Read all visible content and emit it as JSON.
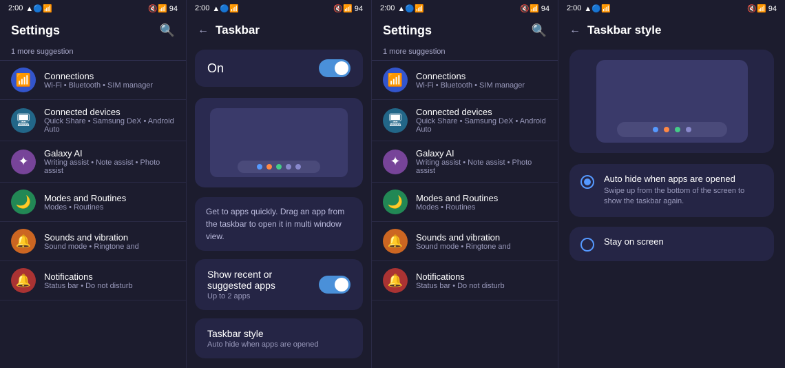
{
  "left_screen": {
    "status_bar": {
      "time": "2:00",
      "battery": "94"
    },
    "settings": {
      "title": "Settings",
      "suggestion": "1 more suggestion",
      "items": [
        {
          "id": "connections",
          "title": "Connections",
          "subtitle": "Wi-Fi • Bluetooth • SIM manager",
          "icon": "📶",
          "icon_color": "#2255cc"
        },
        {
          "id": "connected_devices",
          "title": "Connected devices",
          "subtitle": "Quick Share • Samsung DeX • Android Auto",
          "icon": "🖥",
          "icon_color": "#225588"
        },
        {
          "id": "galaxy_ai",
          "title": "Galaxy AI",
          "subtitle": "Writing assist • Note assist • Photo assist",
          "icon": "✦",
          "icon_color": "#774499"
        },
        {
          "id": "modes_routines",
          "title": "Modes and Routines",
          "subtitle": "Modes • Routines",
          "icon": "🌙",
          "icon_color": "#228855"
        },
        {
          "id": "sounds",
          "title": "Sounds and vibration",
          "subtitle": "Sound mode • Ringtone and",
          "icon": "🔔",
          "icon_color": "#cc6622"
        },
        {
          "id": "notifications",
          "title": "Notifications",
          "subtitle": "Status bar • Do not disturb",
          "icon": "🔔",
          "icon_color": "#aa3333"
        }
      ]
    }
  },
  "taskbar_panel": {
    "status_bar": {
      "time": "2:00",
      "battery": "94"
    },
    "title": "Taskbar",
    "on_label": "On",
    "on_toggle": true,
    "info_text": "Get to apps quickly. Drag an app from the taskbar to open it in multi window view.",
    "show_recent": {
      "title": "Show recent or suggested apps",
      "subtitle": "Up to 2 apps",
      "toggle": true
    },
    "taskbar_style": {
      "title": "Taskbar style",
      "subtitle": "Auto hide when apps are opened"
    },
    "preview_dots": [
      "blue",
      "orange",
      "green",
      "gray",
      "gray"
    ]
  },
  "right_screen": {
    "status_bar": {
      "time": "2:00",
      "battery": "94"
    },
    "settings": {
      "title": "Settings",
      "suggestion": "1 more suggestion",
      "items": [
        {
          "id": "connections",
          "title": "Connections",
          "subtitle": "Wi-Fi • Bluetooth • SIM manager",
          "icon": "📶",
          "icon_color": "#2255cc"
        },
        {
          "id": "connected_devices",
          "title": "Connected devices",
          "subtitle": "Quick Share • Samsung DeX • Android Auto",
          "icon": "🖥",
          "icon_color": "#225588"
        },
        {
          "id": "galaxy_ai",
          "title": "Galaxy AI",
          "subtitle": "Writing assist • Note assist • Photo assist",
          "icon": "✦",
          "icon_color": "#774499"
        },
        {
          "id": "modes_routines",
          "title": "Modes and Routines",
          "subtitle": "Modes • Routines",
          "icon": "🌙",
          "icon_color": "#228855"
        },
        {
          "id": "sounds",
          "title": "Sounds and vibration",
          "subtitle": "Sound mode • Ringtone and",
          "icon": "🔔",
          "icon_color": "#cc6622"
        },
        {
          "id": "notifications",
          "title": "Notifications",
          "subtitle": "Status bar • Do not disturb",
          "icon": "🔔",
          "icon_color": "#aa3333"
        }
      ]
    }
  },
  "taskbar_style_panel": {
    "title": "Taskbar style",
    "options": [
      {
        "id": "auto_hide",
        "title": "Auto hide when apps are opened",
        "subtitle": "Swipe up from the bottom of the screen to show the taskbar again.",
        "selected": true
      },
      {
        "id": "stay_on_screen",
        "title": "Stay on screen",
        "subtitle": "",
        "selected": false
      }
    ]
  }
}
